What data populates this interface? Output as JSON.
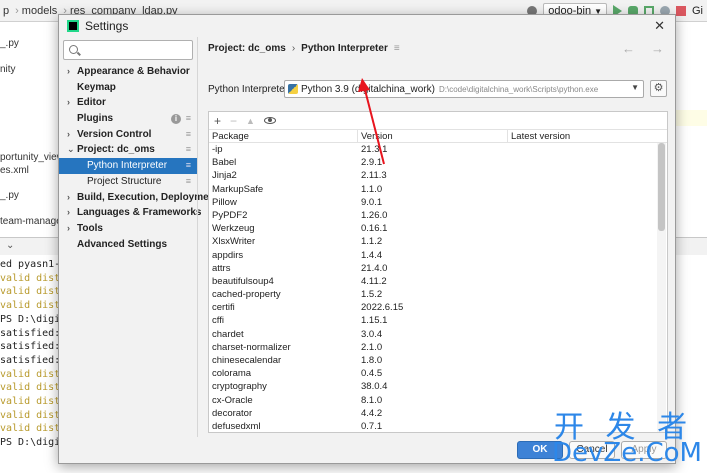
{
  "ide": {
    "breadcrumbs": [
      "p",
      "models",
      "res_company_ldap.py"
    ],
    "run_config": "odoo-bin",
    "git_label": "Gi",
    "left_files": [
      "_.py",
      "nity",
      "portunity_view.x",
      "es.xml",
      "_.py",
      "team-manage"
    ],
    "terminal_lines": [
      {
        "text": "ed pyasn1-mo",
        "warn": false
      },
      {
        "text": "valid distr",
        "warn": true
      },
      {
        "text": "valid distr",
        "warn": true
      },
      {
        "text": "valid distr",
        "warn": true
      },
      {
        "text": "PS D:\\digita",
        "warn": false
      },
      {
        "text": "satisfied: p",
        "warn": false
      },
      {
        "text": "satisfied: p",
        "warn": false
      },
      {
        "text": "satisfied: p",
        "warn": false
      },
      {
        "text": "valid distr",
        "warn": true
      },
      {
        "text": "valid distr",
        "warn": true
      },
      {
        "text": "valid distr",
        "warn": true
      },
      {
        "text": "valid distr",
        "warn": true
      },
      {
        "text": "valid distr",
        "warn": true
      },
      {
        "text": "PS D:\\digita",
        "warn": false
      }
    ]
  },
  "dialog": {
    "title": "Settings",
    "close_glyph": "✕",
    "search_placeholder": "",
    "tree": [
      {
        "label": "Appearance & Behavior",
        "bold": true,
        "chevron": "›",
        "child": false,
        "badge": ""
      },
      {
        "label": "Keymap",
        "bold": true,
        "chevron": "",
        "child": false,
        "badge": ""
      },
      {
        "label": "Editor",
        "bold": true,
        "chevron": "›",
        "child": false,
        "badge": ""
      },
      {
        "label": "Plugins",
        "bold": true,
        "chevron": "",
        "child": false,
        "badge": "≡",
        "info": true
      },
      {
        "label": "Version Control",
        "bold": true,
        "chevron": "›",
        "child": false,
        "badge": "≡"
      },
      {
        "label": "Project: dc_oms",
        "bold": true,
        "chevron": "⌄",
        "child": false,
        "badge": "≡"
      },
      {
        "label": "Python Interpreter",
        "bold": false,
        "chevron": "",
        "child": true,
        "badge": "≡",
        "selected": true
      },
      {
        "label": "Project Structure",
        "bold": false,
        "chevron": "",
        "child": true,
        "badge": "≡"
      },
      {
        "label": "Build, Execution, Deployment",
        "bold": true,
        "chevron": "›",
        "child": false,
        "badge": ""
      },
      {
        "label": "Languages & Frameworks",
        "bold": true,
        "chevron": "›",
        "child": false,
        "badge": ""
      },
      {
        "label": "Tools",
        "bold": true,
        "chevron": "›",
        "child": false,
        "badge": ""
      },
      {
        "label": "Advanced Settings",
        "bold": true,
        "chevron": "",
        "child": false,
        "badge": ""
      }
    ],
    "breadcrumb": {
      "project": "Project: dc_oms",
      "arrow": "›",
      "page": "Python Interpreter",
      "menu": "≡"
    },
    "nav": {
      "back": "←",
      "forward": "→"
    },
    "interpreter": {
      "label": "Python Interpreter:",
      "name": "Python 3.9 (digitalchina_work)",
      "path": "D:\\code\\digitalchina_work\\Scripts\\python.exe"
    },
    "toolbar": {
      "add": "+",
      "remove": "−",
      "up": "▲"
    },
    "columns": [
      "Package",
      "Version",
      "Latest version"
    ],
    "packages": [
      [
        "-ip",
        "21.3.1"
      ],
      [
        "Babel",
        "2.9.1"
      ],
      [
        "Jinja2",
        "2.11.3"
      ],
      [
        "MarkupSafe",
        "1.1.0"
      ],
      [
        "Pillow",
        "9.0.1"
      ],
      [
        "PyPDF2",
        "1.26.0"
      ],
      [
        "Werkzeug",
        "0.16.1"
      ],
      [
        "XlsxWriter",
        "1.1.2"
      ],
      [
        "appdirs",
        "1.4.4"
      ],
      [
        "attrs",
        "21.4.0"
      ],
      [
        "beautifulsoup4",
        "4.11.2"
      ],
      [
        "cached-property",
        "1.5.2"
      ],
      [
        "certifi",
        "2022.6.15"
      ],
      [
        "cffi",
        "1.15.1"
      ],
      [
        "chardet",
        "3.0.4"
      ],
      [
        "charset-normalizer",
        "2.1.0"
      ],
      [
        "chinesecalendar",
        "1.8.0"
      ],
      [
        "colorama",
        "0.4.5"
      ],
      [
        "cryptography",
        "38.0.4"
      ],
      [
        "cx-Oracle",
        "8.1.0"
      ],
      [
        "decorator",
        "4.4.2"
      ],
      [
        "defusedxml",
        "0.7.1"
      ]
    ],
    "buttons": {
      "ok": "OK",
      "cancel": "Cancel",
      "apply": "Apply"
    }
  },
  "watermark": {
    "cn": "开 发 者",
    "en": "DevZe.CoM"
  },
  "colors": {
    "selection": "#2675bf",
    "accent": "#3d82d6",
    "arrow": "#e8141e",
    "watermark": "#2d87e8"
  }
}
